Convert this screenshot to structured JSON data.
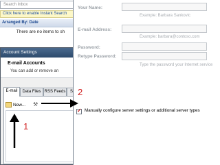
{
  "inbox": {
    "search_placeholder": "Search Inbox",
    "instant_search_bar": "Click here to enable Instant Search",
    "arranged_by": "Arranged By: Date",
    "empty_message": "There are no items to sh"
  },
  "account_settings": {
    "title": "Account Settings",
    "heading": "E-mail Accounts",
    "subtitle": "You can add or remove an",
    "tabs": [
      "E-mail",
      "Data Files",
      "RSS Feeds",
      "S"
    ],
    "new_label": "New..."
  },
  "add_account": {
    "your_name_label": "Your Name:",
    "your_name_example": "Example: Barbara Sankovic",
    "email_label": "E-mail Address:",
    "email_example": "Example: barbara@contoso.com",
    "password_label": "Password:",
    "retype_label": "Retype Password:",
    "retype_hint": "Type the password your Internet service",
    "manual_config_label": "Manually configure server settings or additional server types",
    "manual_config_checked": true
  },
  "annotations": {
    "step1": "1",
    "step2": "2",
    "color": "#d01f1f"
  },
  "colors": {
    "instant_search_bg": "#fdf8c8",
    "titlebar": "#2c4a6c"
  }
}
